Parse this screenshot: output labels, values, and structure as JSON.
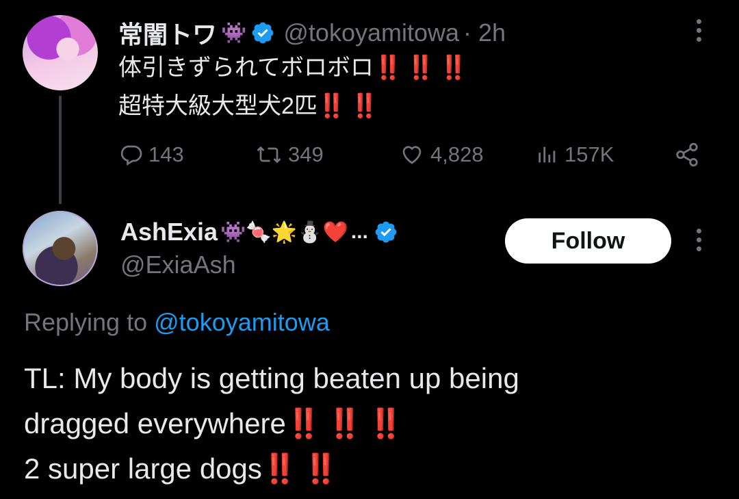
{
  "tweet": {
    "display_name": "常闇トワ",
    "name_emoji": "👾",
    "handle": "@tokoyamitowa",
    "time": "· 2h",
    "text_line1": "体引きずられてボロボロ",
    "text_line1_bangs": "‼️ ‼️ ‼️",
    "text_line2": "超特大級大型犬2匹",
    "text_line2_bangs": "‼️ ‼️",
    "stats": {
      "replies": "143",
      "retweets": "349",
      "likes": "4,828",
      "views": "157K"
    }
  },
  "reply": {
    "display_name": "AshExia",
    "name_emojis": "👾🍬🌟⛄❤️",
    "ellipsis": "...",
    "handle": "@ExiaAsh",
    "follow_label": "Follow",
    "replying_to_label": "Replying to",
    "replying_to_handle": "@tokoyamitowa",
    "text_line1": "TL: My body is getting beaten up being",
    "text_line2": "dragged everywhere",
    "text_line2_bangs": "‼️ ‼️ ‼️",
    "text_line3": "2 super large dogs",
    "text_line3_bangs": "‼️ ‼️"
  },
  "colors": {
    "background": "#000000",
    "text": "#e7e9ea",
    "muted": "#71767b",
    "link": "#1d9bf0",
    "verified": "#1d9bf0",
    "bang": "#e0245e"
  }
}
